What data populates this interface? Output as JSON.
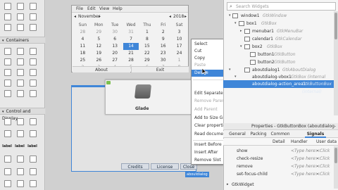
{
  "palette": {
    "sections": [
      {
        "label": "Containers",
        "arrow": "▾"
      },
      {
        "label": "Control and Display",
        "arrow": "▾"
      }
    ],
    "bold_labels": [
      "label",
      "label",
      "label"
    ]
  },
  "calendar_window": {
    "menu": [
      "File",
      "Edit",
      "View",
      "Help"
    ],
    "month": "November",
    "year": "2018",
    "weekdays": [
      "Sun",
      "Mon",
      "Tue",
      "Wed",
      "Thu",
      "Fri",
      "Sat"
    ],
    "weeks": [
      [
        "28",
        "29",
        "30",
        "31",
        "1",
        "2",
        "3"
      ],
      [
        "4",
        "5",
        "6",
        "7",
        "8",
        "9",
        "10"
      ],
      [
        "11",
        "12",
        "13",
        "14",
        "15",
        "16",
        "17"
      ],
      [
        "18",
        "19",
        "20",
        "21",
        "22",
        "23",
        "24"
      ],
      [
        "25",
        "26",
        "27",
        "28",
        "29",
        "30",
        "1"
      ],
      [
        "2",
        "3",
        "4",
        "5",
        "6",
        "7",
        "8"
      ]
    ],
    "selected_day": "14",
    "buttons": [
      "About",
      "Exit"
    ]
  },
  "dialog": {
    "glade_label": "Glade",
    "buttons": [
      "Credits",
      "License",
      "Close"
    ],
    "tag": "aboutdialog"
  },
  "context_menu": {
    "items": [
      {
        "label": "Select",
        "state": "normal"
      },
      {
        "label": "Cut",
        "state": "normal"
      },
      {
        "label": "Copy",
        "state": "normal"
      },
      {
        "label": "Paste",
        "state": "disabled"
      },
      {
        "label": "Delete",
        "state": "highlight"
      },
      {
        "label": "Edit Separately",
        "state": "normal"
      },
      {
        "label": "Remove Parent",
        "state": "disabled"
      },
      {
        "label": "Add Parent",
        "state": "disabled"
      },
      {
        "label": "Add to Size Group",
        "state": "normal"
      },
      {
        "label": "Clear properties",
        "state": "normal"
      },
      {
        "label": "Read documentation",
        "state": "normal"
      },
      {
        "label": "Insert Before",
        "state": "normal"
      },
      {
        "label": "Insert After",
        "state": "normal"
      },
      {
        "label": "Remove Slot",
        "state": "normal"
      }
    ]
  },
  "inspector": {
    "search_placeholder": "Search Widgets",
    "tree": [
      {
        "name": "window1",
        "type": "GtkWindow"
      },
      {
        "name": "box1",
        "type": "GtkBox"
      },
      {
        "name": "menubar1",
        "type": "GtkMenuBar"
      },
      {
        "name": "calendar1",
        "type": "GtkCalendar"
      },
      {
        "name": "box2",
        "type": "GtkBox"
      },
      {
        "name": "button1",
        "type": "GtkButton"
      },
      {
        "name": "button2",
        "type": "GtkButton"
      },
      {
        "name": "aboutdialog1",
        "type": "GtkAboutDialog"
      },
      {
        "name": "aboutdialog-vbox1",
        "type": "GtkBox (internal vbox)"
      },
      {
        "name": "aboutdialog-action_area1",
        "type": "GtkButtonBox (internal)"
      }
    ],
    "properties_title": "Properties - GtkButtonBox (aboutdialog-action...",
    "tabs": [
      "General",
      "Packing",
      "Common",
      "Signals"
    ],
    "signal_headers": [
      "Detail",
      "Handler",
      "User data"
    ],
    "signals": [
      {
        "name": "show",
        "handler": "<Type here>",
        "user": "<Click"
      },
      {
        "name": "check-resize",
        "handler": "<Type here>",
        "user": "<Click"
      },
      {
        "name": "remove",
        "handler": "<Type here>",
        "user": "<Click"
      },
      {
        "name": "set-focus-child",
        "handler": "<Type here>",
        "user": "<Click"
      }
    ],
    "group": "GtkWidget"
  },
  "colors": {
    "accent": "#3f86d8",
    "panel": "#f5f5f5",
    "canvas": "#d0d0d0"
  }
}
